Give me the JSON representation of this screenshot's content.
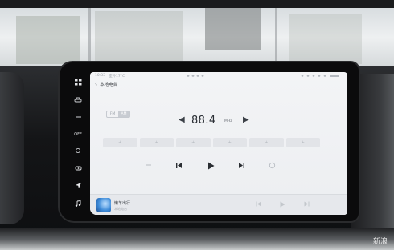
{
  "status_bar": {
    "time": "10:33",
    "temperature": "室外17°C"
  },
  "header": {
    "back_glyph": "‹",
    "title": "本地电台"
  },
  "band": {
    "options": [
      "FM",
      "AM"
    ],
    "selected": "AM"
  },
  "tuner": {
    "frequency": "88.4",
    "unit": "MHz",
    "prev_glyph": "◀",
    "next_glyph": "▶"
  },
  "presets": [
    "+",
    "+",
    "+",
    "+",
    "+",
    "+"
  ],
  "mini_player": {
    "title": "懒羊出行",
    "subtitle": "本地电台"
  },
  "dock": {
    "app_label": "OFF"
  },
  "watermark": "新浪",
  "colors": {
    "screen_bg": "#eceef1",
    "text_dark": "#2b2f35",
    "accent_cover": "#3d8bd9"
  },
  "icons": {
    "dock": [
      "grid-icon",
      "car-icon",
      "menu-icon",
      "fan-icon",
      "seat-icon",
      "navigation-icon",
      "music-icon"
    ],
    "controls": [
      "list-icon",
      "previous-icon",
      "play-icon",
      "next-icon",
      "refresh-icon"
    ]
  }
}
